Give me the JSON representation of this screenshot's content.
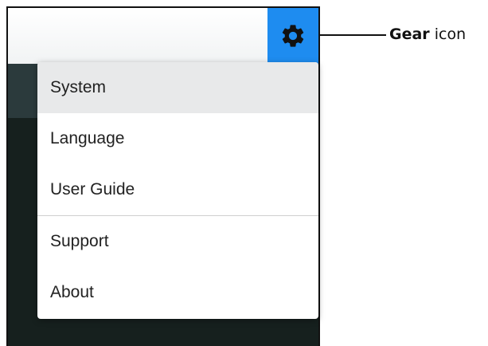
{
  "app": {
    "toolbar": {
      "gear_icon": "gear-icon",
      "gear_button_color": "#1e8cf0"
    }
  },
  "menu": {
    "selected_index": 0,
    "items": [
      {
        "label": "System"
      },
      {
        "label": "Language"
      },
      {
        "label": "User Guide"
      },
      {
        "label": "Support"
      },
      {
        "label": "About"
      }
    ]
  },
  "callout": {
    "strong": "Gear",
    "rest": " icon"
  }
}
